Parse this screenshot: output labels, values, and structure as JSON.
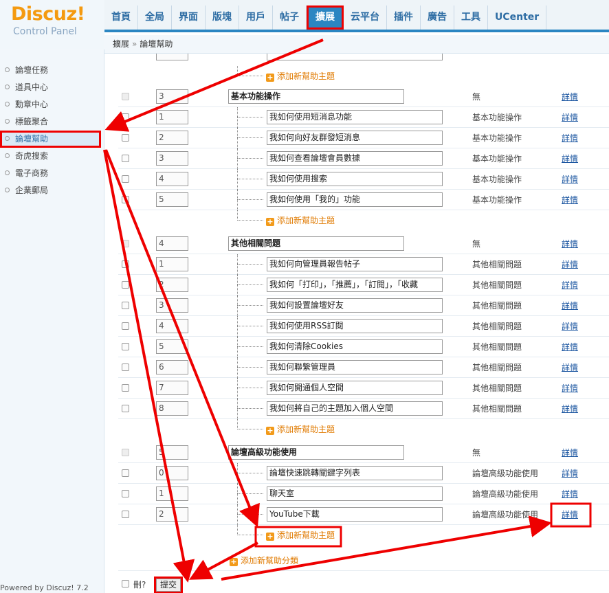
{
  "brand": {
    "name": "Discuz!",
    "subtitle": "Control Panel"
  },
  "nav": {
    "tabs": [
      "首頁",
      "全局",
      "界面",
      "版塊",
      "用戶",
      "帖子",
      "擴展",
      "云平台",
      "插件",
      "廣告",
      "工具",
      "UCenter"
    ],
    "active_index": 6
  },
  "breadcrumb": {
    "parent": "擴展",
    "separator": "»",
    "current": "論壇幫助"
  },
  "sidebar": {
    "items": [
      "論壇任務",
      "道具中心",
      "勳章中心",
      "標籤聚合",
      "論壇幫助",
      "奇虎搜索",
      "電子商務",
      "企業郵局"
    ],
    "active_index": 4
  },
  "footer": {
    "powered": "Powered by Discuz! 7.2"
  },
  "main": {
    "add_topic_label": "添加新幫助主題",
    "add_category_label": "添加新幫助分類",
    "detail_label": "詳情",
    "delete_label": "刪?",
    "submit_label": "提交",
    "top_add_topic_label": "添加新幫助主題",
    "categories": [
      {
        "order": "3",
        "title": "基本功能操作",
        "category": "無",
        "items": [
          {
            "order": "1",
            "title": "我如何使用短消息功能",
            "category": "基本功能操作"
          },
          {
            "order": "2",
            "title": "我如何向好友群發短消息",
            "category": "基本功能操作"
          },
          {
            "order": "3",
            "title": "我如何查看論壇會員數據",
            "category": "基本功能操作"
          },
          {
            "order": "4",
            "title": "我如何使用搜索",
            "category": "基本功能操作"
          },
          {
            "order": "5",
            "title": "我如何使用「我的」功能",
            "category": "基本功能操作"
          }
        ]
      },
      {
        "order": "4",
        "title": "其他相關問題",
        "category": "無",
        "items": [
          {
            "order": "1",
            "title": "我如何向管理員報告帖子",
            "category": "其他相關問題"
          },
          {
            "order": "2",
            "title": "我如何「打印」，「推薦」，「訂閱」，「收藏",
            "category": "其他相關問題"
          },
          {
            "order": "3",
            "title": "我如何設置論壇好友",
            "category": "其他相關問題"
          },
          {
            "order": "4",
            "title": "我如何使用RSS訂閱",
            "category": "其他相關問題"
          },
          {
            "order": "5",
            "title": "我如何清除Cookies",
            "category": "其他相關問題"
          },
          {
            "order": "6",
            "title": "我如何聯繫管理員",
            "category": "其他相關問題"
          },
          {
            "order": "7",
            "title": "我如何開通個人空間",
            "category": "其他相關問題"
          },
          {
            "order": "8",
            "title": "我如何將自己的主題加入個人空間",
            "category": "其他相關問題"
          }
        ]
      },
      {
        "order": "5",
        "title": "論壇高級功能使用",
        "category": "無",
        "items": [
          {
            "order": "0",
            "title": "論壇快速跳轉關鍵字列表",
            "category": "論壇高級功能使用"
          },
          {
            "order": "1",
            "title": "聊天室",
            "category": "論壇高級功能使用"
          },
          {
            "order": "2",
            "title": "YouTube下載",
            "category": "論壇高級功能使用"
          }
        ]
      }
    ]
  },
  "colors": {
    "accent": "#2b86c2",
    "annotation": "#e00000",
    "add_link": "#e07a00",
    "link": "#1a55a0"
  }
}
